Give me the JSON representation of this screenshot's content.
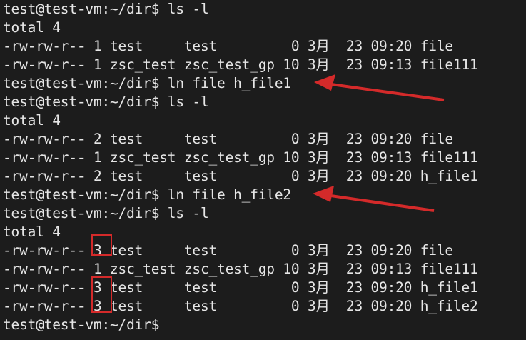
{
  "terminal": {
    "lines": [
      "test@test-vm:~/dir$ ls -l",
      "total 4",
      "-rw-rw-r-- 1 test     test         0 3月  23 09:20 file",
      "-rw-rw-r-- 1 zsc_test zsc_test_gp 10 3月  23 09:13 file111",
      "test@test-vm:~/dir$ ln file h_file1",
      "test@test-vm:~/dir$ ls -l",
      "total 4",
      "-rw-rw-r-- 2 test     test         0 3月  23 09:20 file",
      "-rw-rw-r-- 1 zsc_test zsc_test_gp 10 3月  23 09:13 file111",
      "-rw-rw-r-- 2 test     test         0 3月  23 09:20 h_file1",
      "test@test-vm:~/dir$ ln file h_file2",
      "test@test-vm:~/dir$ ls -l",
      "total 4",
      "-rw-rw-r-- 3 test     test         0 3月  23 09:20 file",
      "-rw-rw-r-- 1 zsc_test zsc_test_gp 10 3月  23 09:13 file111",
      "-rw-rw-r-- 3 test     test         0 3月  23 09:20 h_file1",
      "-rw-rw-r-- 3 test     test         0 3月  23 09:20 h_file2",
      "test@test-vm:~/dir$"
    ]
  },
  "annotations": {
    "color": "#d42a2a"
  }
}
